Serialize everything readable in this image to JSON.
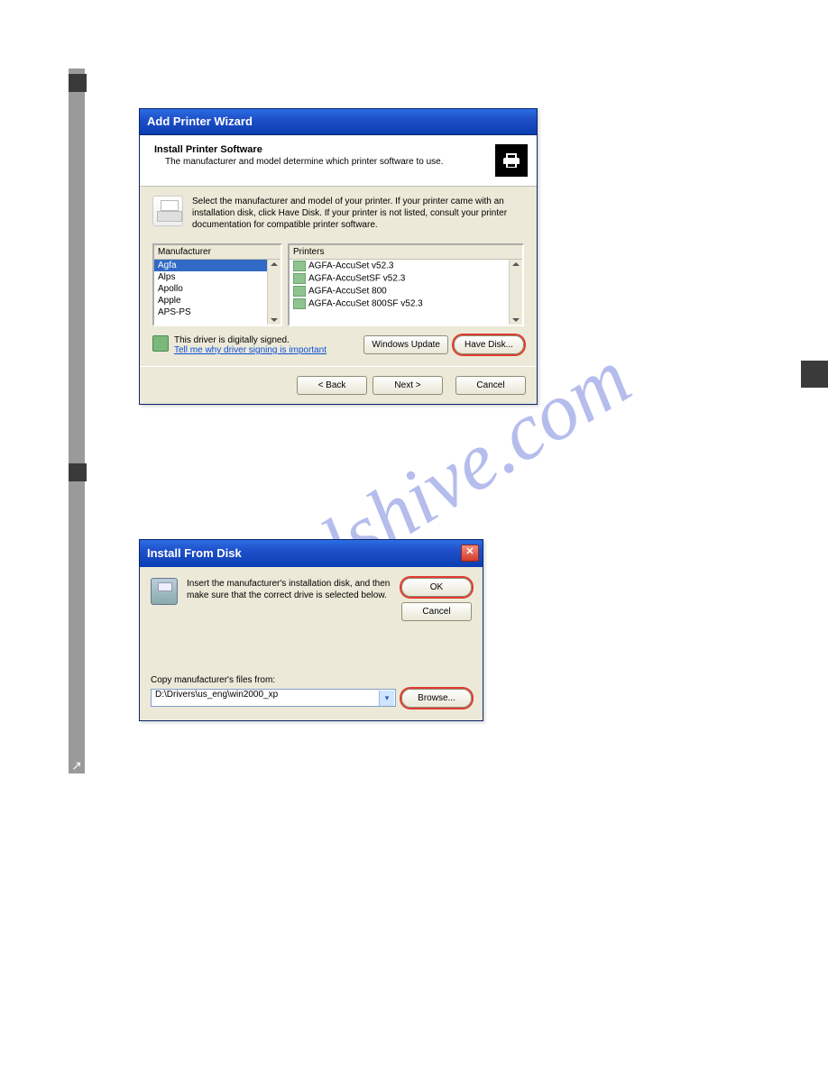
{
  "sidebar": {
    "share_glyph": "↗"
  },
  "wizard": {
    "title": "Add Printer Wizard",
    "header_title": "Install Printer Software",
    "header_sub": "The manufacturer and model determine which printer software to use.",
    "instructions": "Select the manufacturer and model of your printer. If your printer came with an installation disk, click Have Disk. If your printer is not listed, consult your printer documentation for compatible printer software.",
    "columns": {
      "manufacturer_label": "Manufacturer",
      "printers_label": "Printers"
    },
    "manufacturers": [
      "Agfa",
      "Alps",
      "Apollo",
      "Apple",
      "APS-PS"
    ],
    "printers": [
      "AGFA-AccuSet v52.3",
      "AGFA-AccuSetSF v52.3",
      "AGFA-AccuSet 800",
      "AGFA-AccuSet 800SF v52.3"
    ],
    "signed_text": "This driver is digitally signed.",
    "signed_link": "Tell me why driver signing is important",
    "buttons": {
      "windows_update": "Windows Update",
      "have_disk": "Have Disk...",
      "back": "< Back",
      "next": "Next >",
      "cancel": "Cancel"
    }
  },
  "disk": {
    "title": "Install From Disk",
    "text": "Insert the manufacturer's installation disk, and then make sure that the correct drive is selected below.",
    "copy_label": "Copy manufacturer's files from:",
    "path_value": "D:\\Drivers\\us_eng\\win2000_xp",
    "buttons": {
      "ok": "OK",
      "cancel": "Cancel",
      "browse": "Browse..."
    }
  },
  "watermark": "manualshive.com"
}
